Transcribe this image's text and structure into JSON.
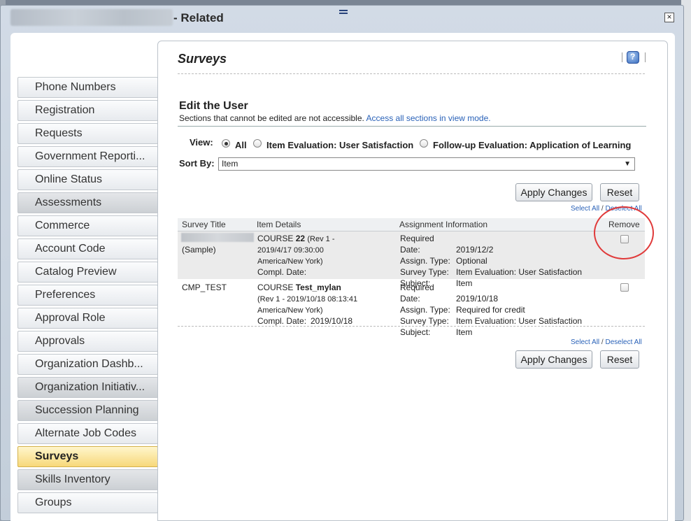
{
  "window": {
    "title": "- Related",
    "close_glyph": "×"
  },
  "sidebar": {
    "items": [
      {
        "label": "Phone Numbers",
        "state": "normal"
      },
      {
        "label": "Registration",
        "state": "normal"
      },
      {
        "label": "Requests",
        "state": "normal"
      },
      {
        "label": "Government Reporti...",
        "state": "normal"
      },
      {
        "label": "Online Status",
        "state": "normal"
      },
      {
        "label": "Assessments",
        "state": "dim"
      },
      {
        "label": "Commerce",
        "state": "normal"
      },
      {
        "label": "Account Code",
        "state": "normal"
      },
      {
        "label": "Catalog Preview",
        "state": "normal"
      },
      {
        "label": "Preferences",
        "state": "normal"
      },
      {
        "label": "Approval Role",
        "state": "normal"
      },
      {
        "label": "Approvals",
        "state": "normal"
      },
      {
        "label": "Organization Dashb...",
        "state": "normal"
      },
      {
        "label": "Organization Initiativ...",
        "state": "dim"
      },
      {
        "label": "Succession Planning",
        "state": "dim"
      },
      {
        "label": "Alternate Job Codes",
        "state": "normal"
      },
      {
        "label": "Surveys",
        "state": "active"
      },
      {
        "label": "Skills Inventory",
        "state": "dim"
      },
      {
        "label": "Groups",
        "state": "normal"
      }
    ]
  },
  "panel": {
    "title": "Surveys",
    "edit": {
      "title": "Edit the User",
      "note": "Sections that cannot be edited are not accessible.",
      "link": "Access all sections in view mode."
    },
    "view": {
      "label": "View:",
      "options": [
        "All",
        "Item Evaluation: User Satisfaction",
        "Follow-up Evaluation: Application of Learning"
      ],
      "selected": "All"
    },
    "sort": {
      "label": "Sort By:",
      "value": "Item"
    },
    "buttons": {
      "apply": "Apply Changes",
      "reset": "Reset"
    },
    "select_all": {
      "select": "Select All",
      "sep": "/",
      "deselect": "Deselect All"
    },
    "table": {
      "headers": [
        "Survey Title",
        "Item Details",
        "Assignment Information",
        "Remove"
      ],
      "rows": [
        {
          "title": "(Sample)",
          "course_prefix": "COURSE",
          "course_name": "22",
          "course_rev": "(Rev 1 - 2019/4/17 09:30:00 America/New York)",
          "compl_label": "Compl. Date:",
          "compl_value": "",
          "required_label": "Required Date:",
          "required_value": "2019/12/2",
          "assign_label": "Assign. Type:",
          "assign_value": "Optional",
          "survey_label": "Survey Type:",
          "survey_value": "Item Evaluation: User Satisfaction",
          "subject_label": "Subject:",
          "subject_value": "Item"
        },
        {
          "title": "CMP_TEST",
          "course_prefix": "COURSE",
          "course_name": "Test_mylan",
          "course_rev": "(Rev 1 - 2019/10/18 08:13:41 America/New York)",
          "compl_label": "Compl. Date:",
          "compl_value": "2019/10/18",
          "required_label": "Required Date:",
          "required_value": "2019/10/18",
          "assign_label": "Assign. Type:",
          "assign_value": "Required for credit",
          "survey_label": "Survey Type:",
          "survey_value": "Item Evaluation: User Satisfaction",
          "subject_label": "Subject:",
          "subject_value": "Item"
        }
      ]
    }
  },
  "colors": {
    "link": "#2a62b8",
    "active_tab": "#f7d87a",
    "annotation": "#e03a3a"
  }
}
